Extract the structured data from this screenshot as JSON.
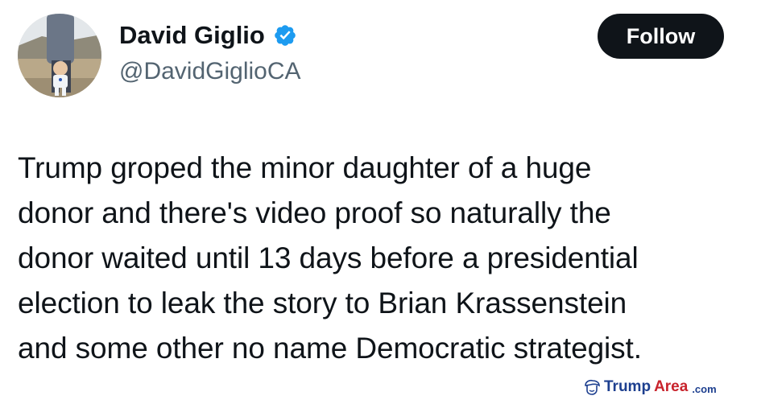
{
  "profile": {
    "display_name": "David Giglio",
    "handle": "@DavidGiglioCA",
    "verified": true,
    "avatar_icon": "avatar-photo"
  },
  "actions": {
    "follow_label": "Follow"
  },
  "tweet": {
    "lines": [
      "Trump groped the minor daughter of a huge",
      "donor and there's video proof so naturally the",
      "donor waited until 13 days before a presidential",
      "election to leak the story to Brian Krassenstein",
      "and some other no name Democratic strategist."
    ]
  },
  "watermark": {
    "part1": "Trump",
    "part2": "Area",
    "part3": ".com"
  },
  "colors": {
    "text_primary": "#0f1419",
    "text_secondary": "#536471",
    "verified_blue": "#1d9bf0",
    "follow_bg": "#0f1419",
    "follow_text": "#ffffff"
  }
}
